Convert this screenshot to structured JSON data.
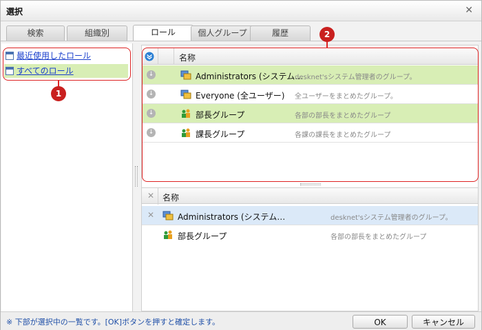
{
  "window": {
    "title": "選択"
  },
  "tabs": [
    {
      "label": "検索",
      "active": false
    },
    {
      "label": "組織別",
      "active": false
    },
    {
      "label": "ロール",
      "active": true
    },
    {
      "label": "個人グループ",
      "active": false
    },
    {
      "label": "履歴",
      "active": false
    }
  ],
  "annotations": {
    "badge1": "1",
    "badge2": "2"
  },
  "roles": [
    {
      "label": "最近使用したロール",
      "selected": false
    },
    {
      "label": "すべてのロール",
      "selected": true
    }
  ],
  "top_table": {
    "column_header": "名称",
    "rows": [
      {
        "name": "Administrators (システム…",
        "desc": "desknet'sシステム管理者のグループ。",
        "icon": "admin-group-icon"
      },
      {
        "name": "Everyone (全ユーザー)",
        "desc": "全ユーザーをまとめたグループ。",
        "icon": "admin-group-icon"
      },
      {
        "name": "部長グループ",
        "desc": "各部の部長をまとめたグループ",
        "icon": "people-group-icon"
      },
      {
        "name": "課長グループ",
        "desc": "各課の課長をまとめたグループ",
        "icon": "people-group-icon"
      }
    ]
  },
  "bottom_table": {
    "column_header": "名称",
    "rows": [
      {
        "name": "Administrators (システム…",
        "desc": "desknet'sシステム管理者のグループ。",
        "icon": "admin-group-icon"
      },
      {
        "name": "部長グループ",
        "desc": "各部の部長をまとめたグループ",
        "icon": "people-group-icon"
      }
    ]
  },
  "footer": {
    "note": "※ 下部が選択中の一覧です。[OK]ボタンを押すと確定します。",
    "ok_label": "OK",
    "cancel_label": "キャンセル"
  },
  "colors": {
    "selected_row": "#d8eeb5",
    "highlight_row": "#dbe9f8",
    "annotation": "#d22222",
    "link": "#1a3fcc"
  }
}
